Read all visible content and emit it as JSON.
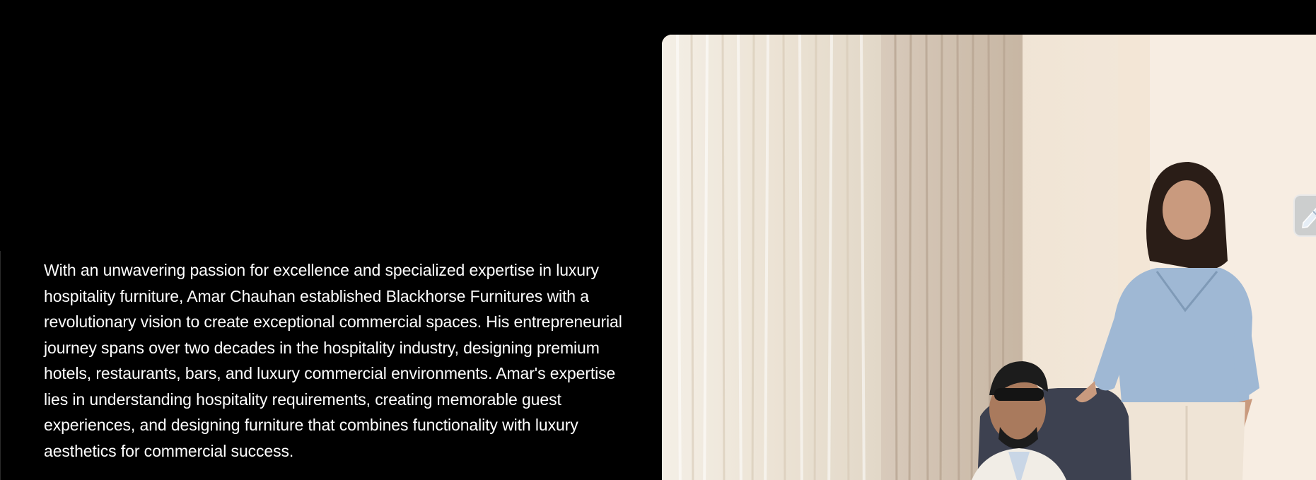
{
  "about": {
    "paragraph": "With an unwavering passion for excellence and specialized expertise in luxury hospitality furniture, Amar Chauhan established Blackhorse Furnitures with a revolutionary vision to create exceptional commercial spaces. His entrepreneurial journey spans over two decades in the hospitality industry, designing premium hotels, restaurants, bars, and luxury commercial environments. Amar's expertise lies in understanding hospitality requirements, creating memorable guest experiences, and designing furniture that combines functionality with luxury aesthetics for commercial success."
  },
  "photo": {
    "icon": "founders-photo"
  },
  "side_button": {
    "icon": "pencil-icon"
  },
  "colors": {
    "background": "#000000",
    "text": "#ffffff"
  }
}
